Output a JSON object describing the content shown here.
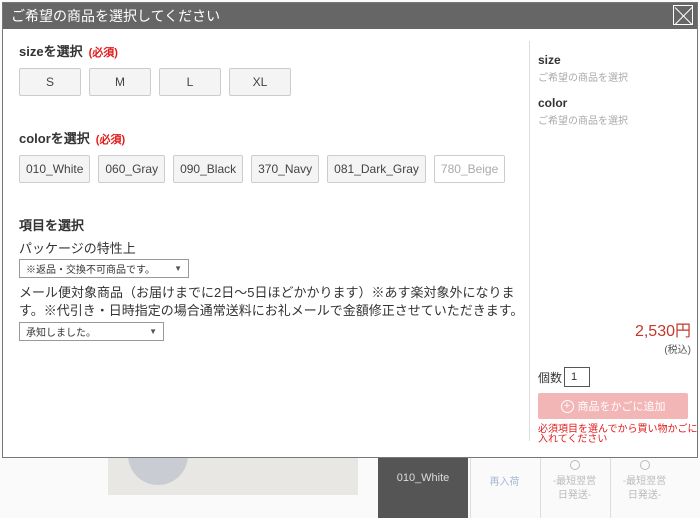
{
  "modal": {
    "title": "ご希望の商品を選択してください"
  },
  "size": {
    "title": "sizeを選択",
    "required": "(必須)",
    "options": [
      "S",
      "M",
      "L",
      "XL"
    ]
  },
  "color": {
    "title": "colorを選択",
    "required": "(必須)",
    "options": [
      "010_White",
      "060_Gray",
      "090_Black",
      "370_Navy",
      "081_Dark_Gray"
    ],
    "disabled_option": "780_Beige"
  },
  "items": {
    "title": "項目を選択",
    "package_label": "パッケージの特性上",
    "package_select": "※返品・交換不可商品です。",
    "mail_note": "メール便対象商品（お届けまでに2日〜5日ほどかかります）※あす楽対象外になります。※代引き・日時指定の場合通常送料にお礼メールで金額修正させていただきます。",
    "mail_select": "承知しました。"
  },
  "summary": {
    "size_label": "size",
    "size_value": "ご希望の商品を選択",
    "color_label": "color",
    "color_value": "ご希望の商品を選択",
    "price": "2,530円",
    "tax": "(税込)",
    "qty_label": "個数",
    "qty_value": "1",
    "cart_button": "商品をかごに追加",
    "warning": "必須項目を選んでから買い物かごに入れてください"
  },
  "background": {
    "color_cell": "010_White",
    "stock_1a": "再入荷",
    "stock_2a": "-最短翌営",
    "stock_2b": "日発送-",
    "stock_3a": "-最短翌営",
    "stock_3b": "日発送-"
  },
  "colors": {
    "titlebar": "#666666",
    "required": "#e21b1b",
    "price": "#c0392b",
    "cart_button": "#f3b6b6"
  }
}
